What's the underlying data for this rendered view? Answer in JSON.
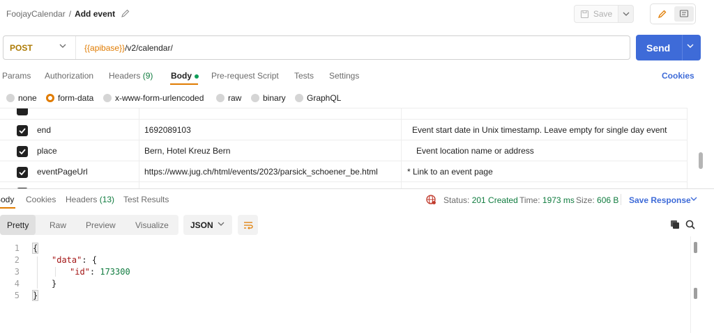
{
  "breadcrumb": {
    "collection": "FoojayCalendar",
    "separator": "/",
    "request": "Add event"
  },
  "toolbar": {
    "save_label": "Save"
  },
  "request": {
    "method": "POST",
    "url_var": "{{apibase}}",
    "url_path": "/v2/calendar/",
    "send_label": "Send"
  },
  "request_tabs": [
    {
      "label": "Params"
    },
    {
      "label": "Authorization"
    },
    {
      "label": "Headers",
      "count": "(9)"
    },
    {
      "label": "Body"
    },
    {
      "label": "Pre-request Script"
    },
    {
      "label": "Tests"
    },
    {
      "label": "Settings"
    }
  ],
  "cookies_label": "Cookies",
  "body_types": [
    "none",
    "form-data",
    "x-www-form-urlencoded",
    "raw",
    "binary",
    "GraphQL"
  ],
  "body_type_selected": "form-data",
  "form_rows": [
    {
      "key": "end",
      "value": "1692089103",
      "description": "Event start date in Unix timestamp. Leave empty for single day event",
      "checked": true
    },
    {
      "key": "place",
      "value": "Bern, Hotel Kreuz Bern",
      "description": "Event location name or address",
      "checked": true
    },
    {
      "key": "eventPageUrl",
      "value": "https://www.jug.ch/html/events/2023/parsick_schoener_be.html",
      "description": "* Link to an event page",
      "checked": true
    }
  ],
  "response_tabs": [
    {
      "label": "Body"
    },
    {
      "label": "Cookies"
    },
    {
      "label": "Headers",
      "count": "(13)"
    },
    {
      "label": "Test Results"
    }
  ],
  "response_meta": {
    "status_label": "Status:",
    "status_value": "201 Created",
    "time_label": "Time:",
    "time_value": "1973 ms",
    "size_label": "Size:",
    "size_value": "606 B",
    "save_response": "Save Response"
  },
  "view_modes": [
    "Pretty",
    "Raw",
    "Preview",
    "Visualize"
  ],
  "format": "JSON",
  "code_lines": [
    "1",
    "2",
    "3",
    "4",
    "5"
  ],
  "code": {
    "open_brace": "{",
    "data_key": "\"data\"",
    "colon": ": ",
    "inner_open": "{",
    "id_key": "\"id\"",
    "id_value": "173300",
    "inner_close": "}",
    "close_brace": "}"
  },
  "colors": {
    "accent": "#e07b00",
    "primary": "#3e6bd8",
    "method": "#ad7a03",
    "success": "#0f7b3e"
  }
}
